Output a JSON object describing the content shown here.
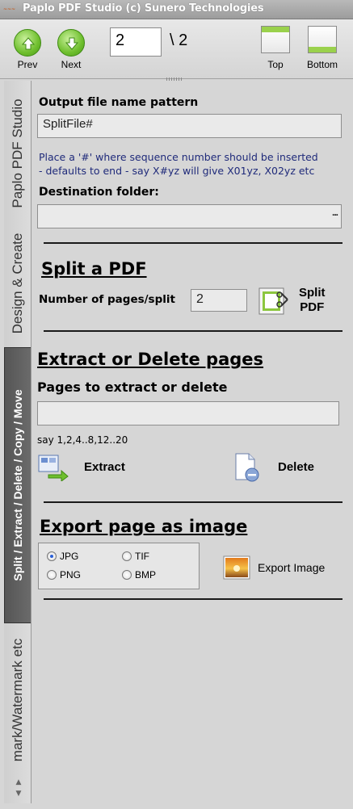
{
  "titlebar": {
    "title": "Paplo PDF Studio (c) Sunero Technologies",
    "icon": "app-logo-icon"
  },
  "toolbar": {
    "prev_label": "Prev",
    "next_label": "Next",
    "current_page": "2",
    "total_pages": "\\ 2",
    "top_label": "Top",
    "bottom_label": "Bottom"
  },
  "sidetabs": {
    "items": [
      {
        "label": "Paplo PDF Studio"
      },
      {
        "label": "Design & Create"
      },
      {
        "label": "Split / Extract / Delete / Copy / Move"
      },
      {
        "label": "mark/Watermark etc"
      }
    ]
  },
  "output": {
    "label": "Output file name pattern",
    "value": "SplitFile#",
    "hint_line1": "Place a '#' where sequence number should be inserted",
    "hint_line2": "- defaults to end - say X#yz will give X01yz, X02yz etc",
    "dest_label": "Destination folder:",
    "dest_value": "",
    "browse_label": "..."
  },
  "split": {
    "heading": "Split a PDF",
    "pages_label": "Number of pages/split",
    "pages_value": "2",
    "button_line1": "Split",
    "button_line2": "PDF"
  },
  "extract": {
    "heading": "Extract or Delete pages",
    "pages_label": "Pages to extract or delete",
    "pages_value": "",
    "example": "say 1,2,4..8,12..20",
    "extract_label": "Extract",
    "delete_label": "Delete"
  },
  "export": {
    "heading": "Export page as image",
    "options": [
      "JPG",
      "TIF",
      "PNG",
      "BMP"
    ],
    "selected": "JPG",
    "button_label": "Export Image"
  }
}
